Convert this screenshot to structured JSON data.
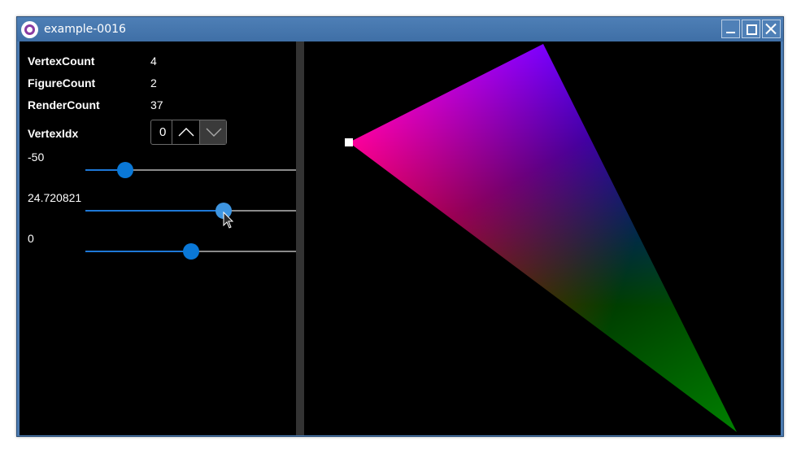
{
  "window": {
    "title": "example-0016"
  },
  "stats": {
    "vertex_count": {
      "label": "VertexCount",
      "value": "4"
    },
    "figure_count": {
      "label": "FigureCount",
      "value": "2"
    },
    "render_count": {
      "label": "RenderCount",
      "value": "37"
    }
  },
  "vertex_idx": {
    "label": "VertexIdx",
    "value": "0"
  },
  "sliders": [
    {
      "label": "-50",
      "fraction": 0.19
    },
    {
      "label": "24.720821",
      "fraction": 0.655
    },
    {
      "label": "0",
      "fraction": 0.5
    }
  ],
  "colors": {
    "accent": "#0a78d7",
    "titlebar": "#4677b0",
    "vertex_red": "#ff0000",
    "vertex_blue": "#0000ff",
    "vertex_green": "#008000"
  }
}
